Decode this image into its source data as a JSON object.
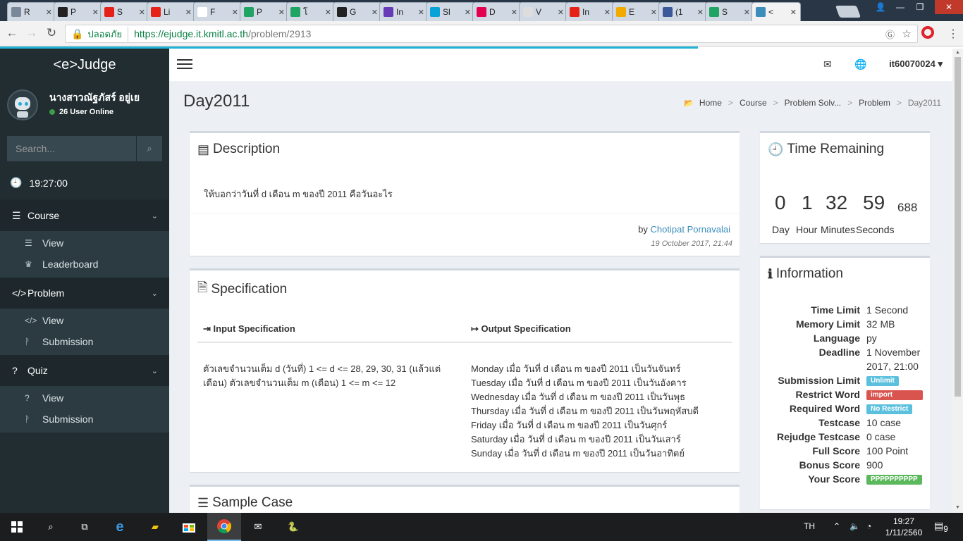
{
  "browser": {
    "tabs": [
      {
        "title": "R",
        "color": "#7a8899"
      },
      {
        "title": "P",
        "color": "#222222"
      },
      {
        "title": "S",
        "color": "#e62117"
      },
      {
        "title": "Li",
        "color": "#e62117"
      },
      {
        "title": "F",
        "color": "#ffffff"
      },
      {
        "title": "P",
        "color": "#1fa463"
      },
      {
        "title": "โ",
        "color": "#1fa463"
      },
      {
        "title": "G",
        "color": "#222222"
      },
      {
        "title": "In",
        "color": "#673ab7"
      },
      {
        "title": "Sl",
        "color": "#0aa3d8"
      },
      {
        "title": "D",
        "color": "#e4004f"
      },
      {
        "title": "V",
        "color": "#dddddd"
      },
      {
        "title": "In",
        "color": "#e62117"
      },
      {
        "title": "E",
        "color": "#f2a900"
      },
      {
        "title": "(1",
        "color": "#3b5998"
      },
      {
        "title": "S",
        "color": "#1fa463"
      },
      {
        "title": "<",
        "color": "#3c8dbc"
      }
    ],
    "close_glyph": "✕",
    "address": {
      "secure_label": "ปลอดภัย",
      "url_host": "https://ejudge.it.kmitl.ac.th",
      "url_path": "/problem/2913"
    }
  },
  "app": {
    "brand": "<e>Judge",
    "user": {
      "name": "นางสาวณัฐภัสร์ อยู่เย",
      "online": "26 User Online"
    },
    "search": {
      "placeholder": "Search..."
    },
    "time": "19:27:00",
    "menu": [
      {
        "label": "Course",
        "icon": "list-icon",
        "glyph": "☰",
        "items": [
          {
            "label": "View",
            "icon": "list-icon",
            "glyph": "☰"
          },
          {
            "label": "Leaderboard",
            "icon": "trophy-icon",
            "glyph": "♛"
          }
        ]
      },
      {
        "label": "Problem",
        "icon": "code-icon",
        "glyph": "</>",
        "items": [
          {
            "label": "View",
            "icon": "code-icon",
            "glyph": "</>"
          },
          {
            "label": "Submission",
            "icon": "branch-icon",
            "glyph": "ᚹ"
          }
        ]
      },
      {
        "label": "Quiz",
        "icon": "question-icon",
        "glyph": "?",
        "items": [
          {
            "label": "View",
            "icon": "question-icon",
            "glyph": "?"
          },
          {
            "label": "Submission",
            "icon": "branch-icon",
            "glyph": "ᚹ"
          }
        ]
      }
    ],
    "topnav": {
      "username": "it60070024"
    },
    "page_title": "Day2011",
    "breadcrumb": [
      "Home",
      "Course",
      "Problem Solv...",
      "Problem",
      "Day2011"
    ],
    "description": {
      "title": "Description",
      "text": "ให้บอกว่าวันที่ d เดือน m ของปี 2011 คือวันอะไร",
      "by_label": "by",
      "author": "Chotipat Pornavalai",
      "date": "19 October 2017, 21:44"
    },
    "specification": {
      "title": "Specification",
      "input_header": "Input Specification",
      "output_header": "Output Specification",
      "input_text": "ตัวเลขจำนวนเต็ม d (วันที่) 1 <= d <= 28, 29, 30, 31 (แล้วแต่เดือน) ตัวเลขจำนวนเต็ม m (เดือน) 1 <= m <= 12",
      "output_lines": [
        "Monday เมื่อ วันที่ d เดือน m ของปี 2011 เป็นวันจันทร์",
        "Tuesday เมื่อ วันที่ d เดือน m ของปี 2011 เป็นวันอังคาร",
        "Wednesday เมื่อ วันที่ d เดือน m ของปี 2011 เป็นวันพุธ",
        "Thursday เมื่อ วันที่ d เดือน m ของปี 2011 เป็นวันพฤหัสบดี",
        "Friday เมื่อ วันที่ d เดือน m ของปี 2011 เป็นวันศุกร์",
        "Saturday เมื่อ วันที่ d เดือน m ของปี 2011 เป็นวันเสาร์",
        "Sunday เมื่อ วันที่ d เดือน m ของปี 2011 เป็นวันอาทิตย์"
      ]
    },
    "sample": {
      "title": "Sample Case"
    },
    "timer": {
      "title": "Time Remaining",
      "day": "0",
      "hour": "1",
      "minutes": "32",
      "seconds": "59",
      "ms": "688",
      "day_label": "Day",
      "hour_label": "Hour",
      "minutes_label": "Minutes",
      "seconds_label": "Seconds"
    },
    "information": {
      "title": "Information",
      "time_limit": "1 Second",
      "memory_limit": "32 MB",
      "language": "py",
      "deadline": "1 November 2017, 21:00",
      "submission_limit": "Unlimit",
      "restrict_word": "import",
      "required_word": "No Restrict",
      "testcase": "10 case",
      "rejudge_testcase": "0 case",
      "full_score": "100 Point",
      "bonus_score": "900",
      "your_score": "PPPPPPPPPP",
      "keys": {
        "time_limit": "Time Limit",
        "memory_limit": "Memory Limit",
        "language": "Language",
        "deadline": "Deadline",
        "submission_limit": "Submission Limit",
        "restrict_word": "Restrict Word",
        "required_word": "Required Word",
        "testcase": "Testcase",
        "rejudge_testcase": "Rejudge Testcase",
        "full_score": "Full Score",
        "bonus_score": "Bonus Score",
        "your_score": "Your Score"
      }
    }
  },
  "taskbar": {
    "lang": "TH",
    "time": "19:27",
    "date": "1/11/2560",
    "notifications": "9"
  },
  "colors": {
    "accent": "#3c8dbc",
    "sidebar": "#222d32",
    "loadbar": "#1fb3d6"
  }
}
